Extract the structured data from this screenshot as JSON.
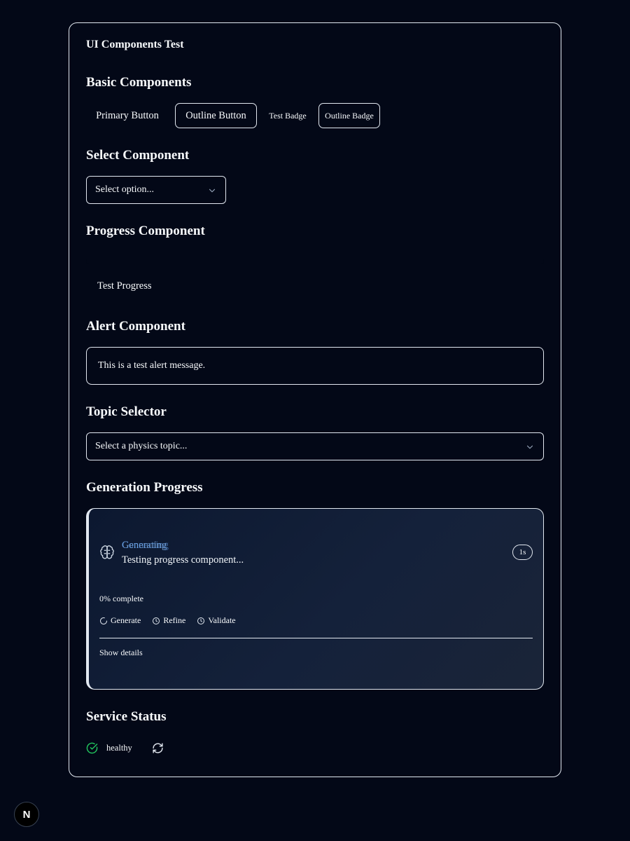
{
  "card": {
    "title": "UI Components Test"
  },
  "basic": {
    "heading": "Basic Components",
    "primary_button": "Primary Button",
    "outline_button": "Outline Button",
    "badge": "Test Badge",
    "outline_badge": "Outline Badge"
  },
  "select": {
    "heading": "Select Component",
    "placeholder": "Select option..."
  },
  "progress": {
    "heading": "Progress Component",
    "label": "Test Progress",
    "value_percent": 0
  },
  "alert": {
    "heading": "Alert Component",
    "message": "This is a test alert message."
  },
  "topic": {
    "heading": "Topic Selector",
    "placeholder": "Select a physics topic..."
  },
  "generation": {
    "heading": "Generation Progress",
    "status_a": "Generating",
    "status_b": "Connecting",
    "message": "Testing progress component...",
    "elapsed": "1s",
    "percent_text": "0% complete",
    "steps": [
      {
        "label": "Generate",
        "icon": "loader-icon"
      },
      {
        "label": "Refine",
        "icon": "clock-icon"
      },
      {
        "label": "Validate",
        "icon": "clock-icon"
      }
    ],
    "details_toggle": "Show details"
  },
  "service": {
    "heading": "Service Status",
    "status": "healthy"
  },
  "dev_indicator": {
    "letter": "N"
  },
  "colors": {
    "background": "#030817",
    "border": "#e2e8f0",
    "healthy": "#22c55e",
    "accent": "#60a5fa"
  }
}
